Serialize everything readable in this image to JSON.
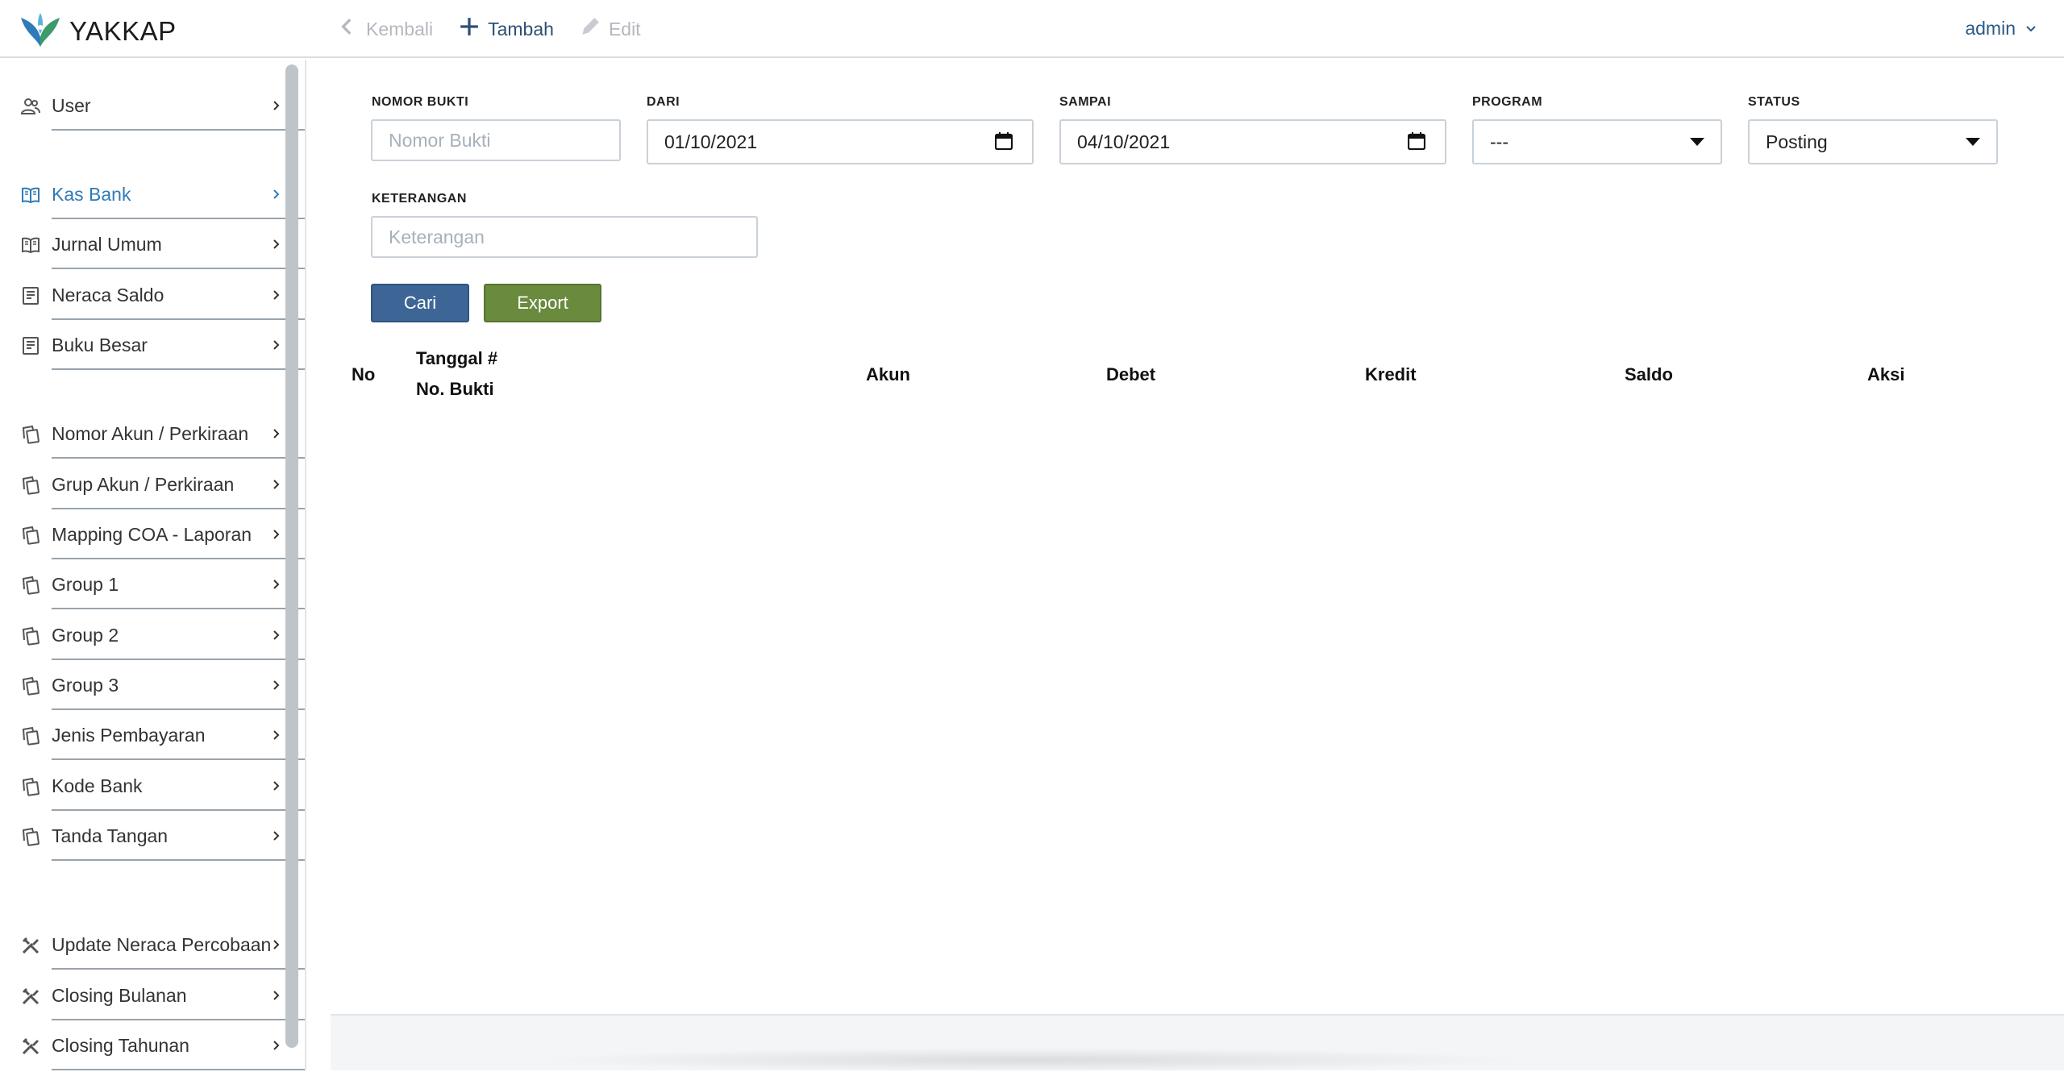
{
  "app": {
    "name": "YAKKAP",
    "brand_color": "#2f7bb8"
  },
  "toolbar": {
    "back_label": "Kembali",
    "add_label": "Tambah",
    "edit_label": "Edit"
  },
  "user_menu": {
    "label": "admin"
  },
  "sidebar": {
    "items": [
      {
        "label": "User",
        "icon": "users-icon"
      },
      {
        "label": "Kas Bank",
        "icon": "book-open-icon",
        "active": true
      },
      {
        "label": "Jurnal Umum",
        "icon": "book-open-icon"
      },
      {
        "label": "Neraca Saldo",
        "icon": "report-icon"
      },
      {
        "label": "Buku Besar",
        "icon": "report-icon"
      },
      {
        "label": "Nomor Akun / Perkiraan",
        "icon": "copy-icon"
      },
      {
        "label": "Grup Akun / Perkiraan",
        "icon": "copy-icon"
      },
      {
        "label": "Mapping COA - Laporan",
        "icon": "copy-icon"
      },
      {
        "label": "Group 1",
        "icon": "copy-icon"
      },
      {
        "label": "Group 2",
        "icon": "copy-icon"
      },
      {
        "label": "Group 3",
        "icon": "copy-icon"
      },
      {
        "label": "Jenis Pembayaran",
        "icon": "copy-icon"
      },
      {
        "label": "Kode Bank",
        "icon": "copy-icon"
      },
      {
        "label": "Tanda Tangan",
        "icon": "copy-icon"
      },
      {
        "label": "Update Neraca Percobaan",
        "icon": "tools-icon"
      },
      {
        "label": "Closing Bulanan",
        "icon": "tools-icon"
      },
      {
        "label": "Closing Tahunan",
        "icon": "tools-icon"
      }
    ]
  },
  "filters": {
    "nomor_bukti": {
      "label": "NOMOR BUKTI",
      "placeholder": "Nomor Bukti",
      "value": ""
    },
    "dari": {
      "label": "DARI",
      "value": "01/10/2021"
    },
    "sampai": {
      "label": "SAMPAI",
      "value": "04/10/2021"
    },
    "program": {
      "label": "PROGRAM",
      "value": "---"
    },
    "status": {
      "label": "STATUS",
      "value": "Posting"
    },
    "keterangan": {
      "label": "KETERANGAN",
      "placeholder": "Keterangan",
      "value": ""
    }
  },
  "actions": {
    "search_label": "Cari",
    "export_label": "Export",
    "search_color": "#3d6696",
    "export_color": "#6a8a3e"
  },
  "table": {
    "headers": {
      "no": "No",
      "tanggal_line1": "Tanggal #",
      "tanggal_line2": "No. Bukti",
      "akun": "Akun",
      "debet": "Debet",
      "kredit": "Kredit",
      "saldo": "Saldo",
      "aksi": "Aksi"
    },
    "rows": []
  }
}
